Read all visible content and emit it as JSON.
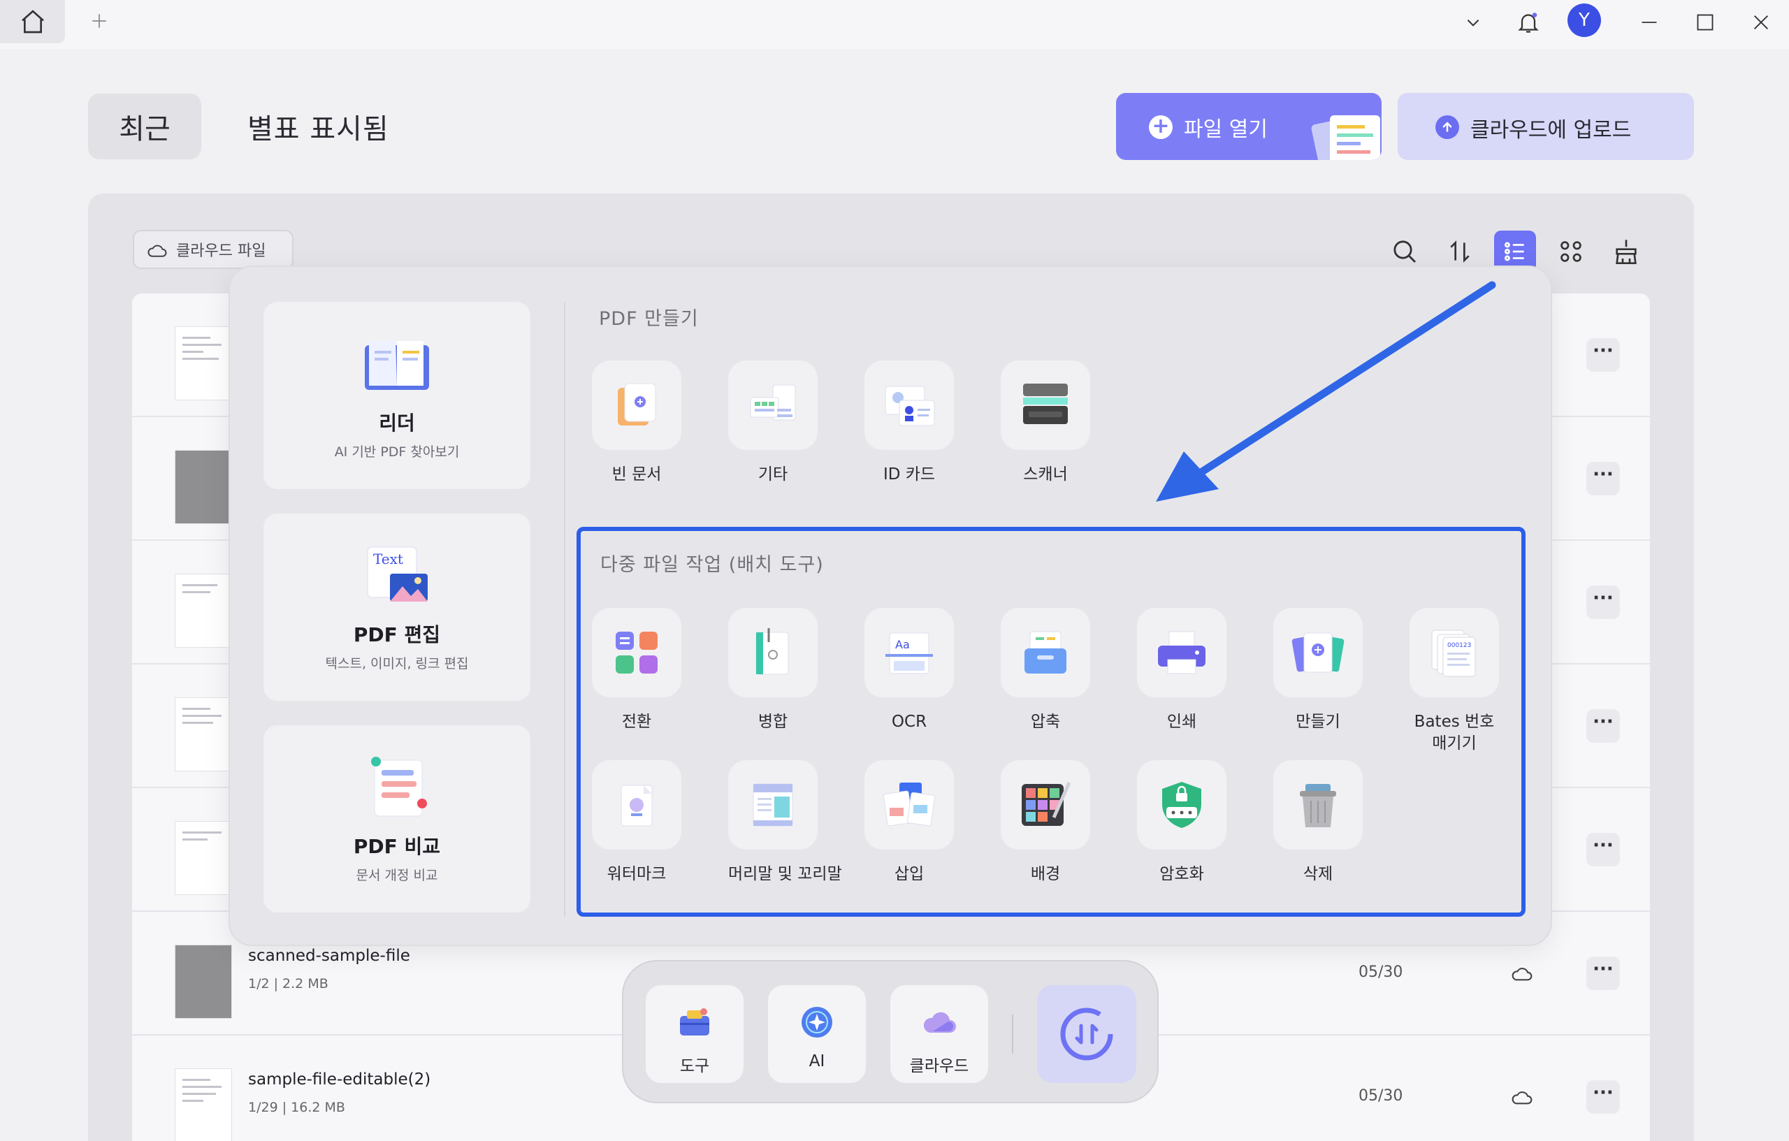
{
  "window": {
    "avatar_letter": "Y"
  },
  "tabs": {
    "recent": "최근",
    "starred": "별표 표시됨"
  },
  "actions": {
    "open_file": "파일 열기",
    "upload_cloud": "클라우드에 업로드"
  },
  "toolbar": {
    "cloud_files": "클라우드 파일"
  },
  "files": [
    {
      "name": "",
      "meta": "",
      "date": ""
    },
    {
      "name": "",
      "meta": "",
      "date": ""
    },
    {
      "name": "",
      "meta": "",
      "date": ""
    },
    {
      "name": "",
      "meta": "",
      "date": ""
    },
    {
      "name": "",
      "meta": "",
      "date": ""
    },
    {
      "name": "scanned-sample-file",
      "meta": "1/2 | 2.2 MB",
      "date": "05/30"
    },
    {
      "name": "sample-file-editable(2)",
      "meta": "1/29 | 16.2 MB",
      "date": "05/30"
    }
  ],
  "popup": {
    "cards": [
      {
        "title": "리더",
        "subtitle": "AI 기반 PDF 찾아보기"
      },
      {
        "title": "PDF 편집",
        "subtitle": "텍스트, 이미지, 링크 편집",
        "icon_text": "Text"
      },
      {
        "title": "PDF 비교",
        "subtitle": "문서 개정 비교"
      }
    ],
    "create_title": "PDF 만들기",
    "create_items": [
      "빈 문서",
      "기타",
      "ID 카드",
      "스캐너"
    ],
    "batch_title": "다중 파일 작업 (배치 도구)",
    "batch_row1": [
      "전환",
      "병합",
      "OCR",
      "압축",
      "인쇄",
      "만들기",
      "Bates 번호\n매기기"
    ],
    "batch_row2": [
      "워터마크",
      "머리말 및 꼬리말",
      "삽입",
      "배경",
      "암호화",
      "삭제"
    ],
    "ocr_icon_text": "Aa",
    "bates_icon_text": "000123"
  },
  "dock": {
    "tools": "도구",
    "ai": "AI",
    "cloud": "클라우드"
  },
  "colors": {
    "accent": "#7d7ef6",
    "highlight": "#2c5ee8",
    "arrow": "#2f66e6"
  }
}
